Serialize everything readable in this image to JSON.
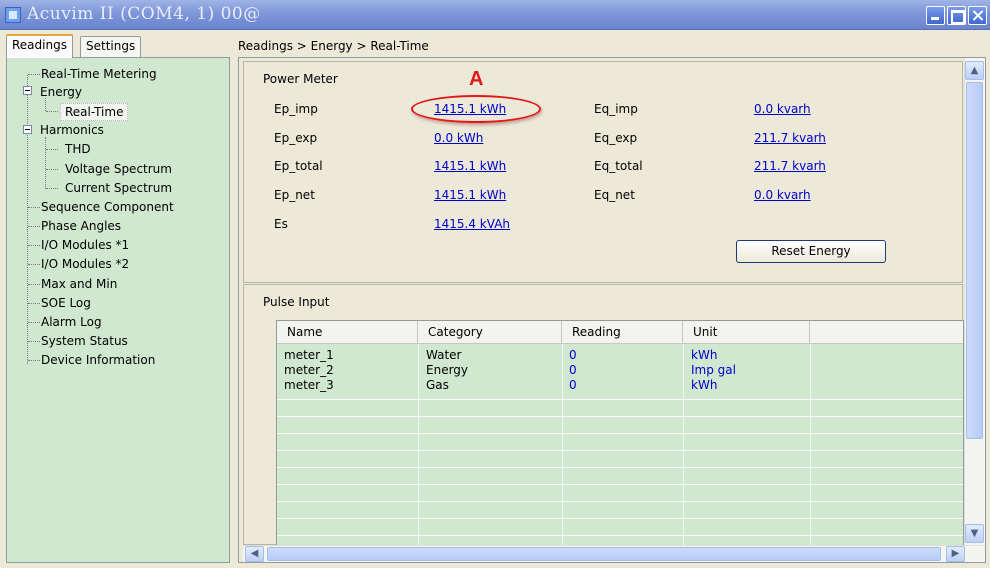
{
  "window": {
    "title": "Acuvim II  (COM4, 1)  00@"
  },
  "left_tabs": [
    {
      "label": "Readings",
      "active": true
    },
    {
      "label": "Settings",
      "active": false
    }
  ],
  "tree": {
    "items": [
      {
        "label": "Real-Time Metering"
      },
      {
        "label": "Energy"
      },
      {
        "label": "Real-Time",
        "selected": true
      },
      {
        "label": "Harmonics"
      },
      {
        "label": "THD"
      },
      {
        "label": "Voltage Spectrum"
      },
      {
        "label": "Current Spectrum"
      },
      {
        "label": "Sequence Component"
      },
      {
        "label": "Phase Angles"
      },
      {
        "label": "I/O Modules *1"
      },
      {
        "label": "I/O Modules *2"
      },
      {
        "label": "Max and Min"
      },
      {
        "label": "SOE Log"
      },
      {
        "label": "Alarm Log"
      },
      {
        "label": "System Status"
      },
      {
        "label": "Device Information"
      }
    ]
  },
  "breadcrumb": "Readings > Energy > Real-Time",
  "power_meter": {
    "title": "Power Meter",
    "ep_imp": {
      "label": "Ep_imp",
      "value": "1415.1 kWh"
    },
    "ep_exp": {
      "label": "Ep_exp",
      "value": "0.0 kWh"
    },
    "ep_total": {
      "label": "Ep_total",
      "value": "1415.1 kWh"
    },
    "ep_net": {
      "label": "Ep_net",
      "value": "1415.1 kWh"
    },
    "es": {
      "label": "Es",
      "value": "1415.4 kVAh"
    },
    "eq_imp": {
      "label": "Eq_imp",
      "value": "0.0 kvarh"
    },
    "eq_exp": {
      "label": "Eq_exp",
      "value": "211.7 kvarh"
    },
    "eq_total": {
      "label": "Eq_total",
      "value": "211.7 kvarh"
    },
    "eq_net": {
      "label": "Eq_net",
      "value": "0.0 kvarh"
    },
    "reset_label": "Reset Energy"
  },
  "annotation": {
    "letter": "A",
    "color": "#e01818"
  },
  "pulse_input": {
    "title": "Pulse Input",
    "columns": [
      "Name",
      "Category",
      "Reading",
      "Unit"
    ],
    "rows": [
      {
        "name": "meter_1",
        "category": "Water",
        "reading": "0",
        "unit": "kWh"
      },
      {
        "name": "meter_2",
        "category": "Energy",
        "reading": "0",
        "unit": "Imp gal"
      },
      {
        "name": "meter_3",
        "category": "Gas",
        "reading": "0",
        "unit": "kWh"
      }
    ]
  },
  "colors": {
    "tree_bg": "#cfe8cf",
    "link": "#0000cc",
    "title_bar": "#7e97d8"
  }
}
